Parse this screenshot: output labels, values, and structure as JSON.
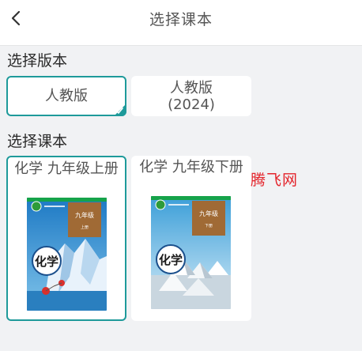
{
  "header": {
    "title": "选择课本",
    "back_icon": "chevron-left-icon"
  },
  "edition_section": {
    "label": "选择版本",
    "options": [
      {
        "label": "人教版",
        "selected": true
      },
      {
        "label_line1": "人教版",
        "label_line2": "(2024)",
        "selected": false
      }
    ]
  },
  "book_section": {
    "label": "选择课本",
    "books": [
      {
        "name": "化学 九年级上册",
        "cover_grade": "九年级",
        "cover_volume": "上册",
        "cover_subject": "化学",
        "selected": true
      },
      {
        "name": "化学 九年级下册",
        "cover_grade": "九年级",
        "cover_volume": "下册",
        "cover_subject": "化学",
        "selected": false
      }
    ]
  },
  "watermark": {
    "text": "腾飞网"
  },
  "colors": {
    "accent": "#1e9a9a",
    "watermark": "#e4242b"
  }
}
